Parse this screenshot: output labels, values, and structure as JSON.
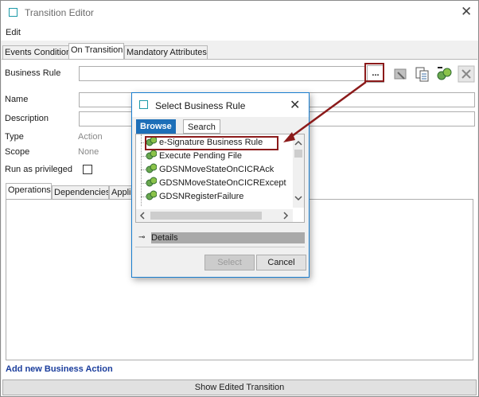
{
  "window": {
    "title": "Transition Editor"
  },
  "menu": {
    "edit": "Edit"
  },
  "tabs": [
    "Events Condition",
    "On Transition",
    "Mandatory Attributes"
  ],
  "form": {
    "business_rule_label": "Business Rule",
    "browse_button": "...",
    "name_label": "Name",
    "description_label": "Description",
    "type_label": "Type",
    "type_value": "Action",
    "scope_label": "Scope",
    "scope_value": "None",
    "privileged_label": "Run as privileged"
  },
  "subtabs": [
    "Operations",
    "Dependencies",
    "Applie"
  ],
  "add_action_link": "Add new Business Action",
  "show_button": "Show Edited Transition",
  "dialog": {
    "title": "Select Business Rule",
    "tabs": {
      "browse": "Browse",
      "search": "Search"
    },
    "tree_items": [
      "e-Signature Business Rule",
      "Execute Pending File",
      "GDSNMoveStateOnCICRAck",
      "GDSNMoveStateOnCICRExcept",
      "GDSNRegisterFailure"
    ],
    "details_label": "Details",
    "select_button": "Select",
    "cancel_button": "Cancel"
  },
  "colors": {
    "accent": "#1d6fb8",
    "annotation": "#8b1a1a",
    "link": "#1a3d9c"
  }
}
